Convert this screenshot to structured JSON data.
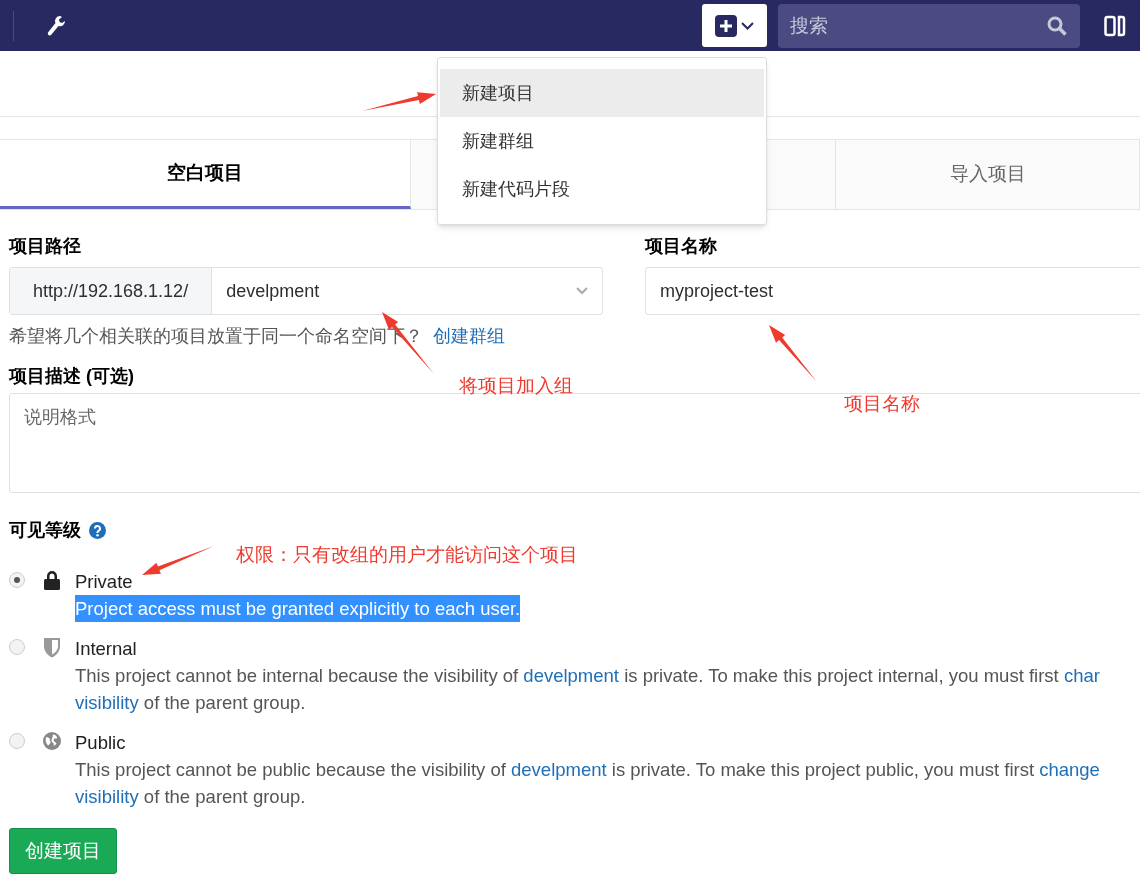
{
  "navbar": {
    "search_placeholder": "搜索"
  },
  "new_menu": {
    "items": [
      {
        "label": "新建项目",
        "selected": true
      },
      {
        "label": "新建群组",
        "selected": false
      },
      {
        "label": "新建代码片段",
        "selected": false
      }
    ]
  },
  "tabs": [
    {
      "label": "空白项目",
      "selected": true
    },
    {
      "label": "导入项目",
      "selected": false
    }
  ],
  "form": {
    "path_label": "项目路径",
    "url_prefix": "http://192.168.1.12/",
    "namespace": "develpment",
    "help_text": "希望将几个相关联的项目放置于同一个命名空间下？",
    "help_link": "创建群组",
    "name_label": "项目名称",
    "name_value": "myproject-test",
    "description_label": "项目描述 (可选)",
    "description_placeholder": "说明格式",
    "visibility_label": "可见等级",
    "visibility_options": [
      {
        "kind": "lock",
        "title": "Private",
        "selected": true,
        "highlighted": true,
        "lines": [
          [
            {
              "text": "Project access must be granted explicitly to each user.",
              "link": false
            }
          ]
        ]
      },
      {
        "kind": "shield",
        "title": "Internal",
        "selected": false,
        "highlighted": false,
        "lines": [
          [
            {
              "text": "This project cannot be internal because the visibility of ",
              "link": false
            },
            {
              "text": "develpment",
              "link": true
            },
            {
              "text": " is private. To make this project internal, you must first ",
              "link": false
            },
            {
              "text": "char",
              "link": true
            }
          ],
          [
            {
              "text": "visibility",
              "link": true
            },
            {
              "text": " of the parent group.",
              "link": false
            }
          ]
        ]
      },
      {
        "kind": "globe",
        "title": "Public",
        "selected": false,
        "highlighted": false,
        "lines": [
          [
            {
              "text": "This project cannot be public because the visibility of ",
              "link": false
            },
            {
              "text": "develpment",
              "link": true
            },
            {
              "text": " is private. To make this project public, you must first ",
              "link": false
            },
            {
              "text": "change",
              "link": true
            }
          ],
          [
            {
              "text": "visibility",
              "link": true
            },
            {
              "text": " of the parent group.",
              "link": false
            }
          ]
        ]
      }
    ],
    "submit": "创建项目"
  },
  "annotations": [
    "将项目加入组",
    "项目名称",
    "权限：只有改组的用户才能访问这个项目"
  ]
}
